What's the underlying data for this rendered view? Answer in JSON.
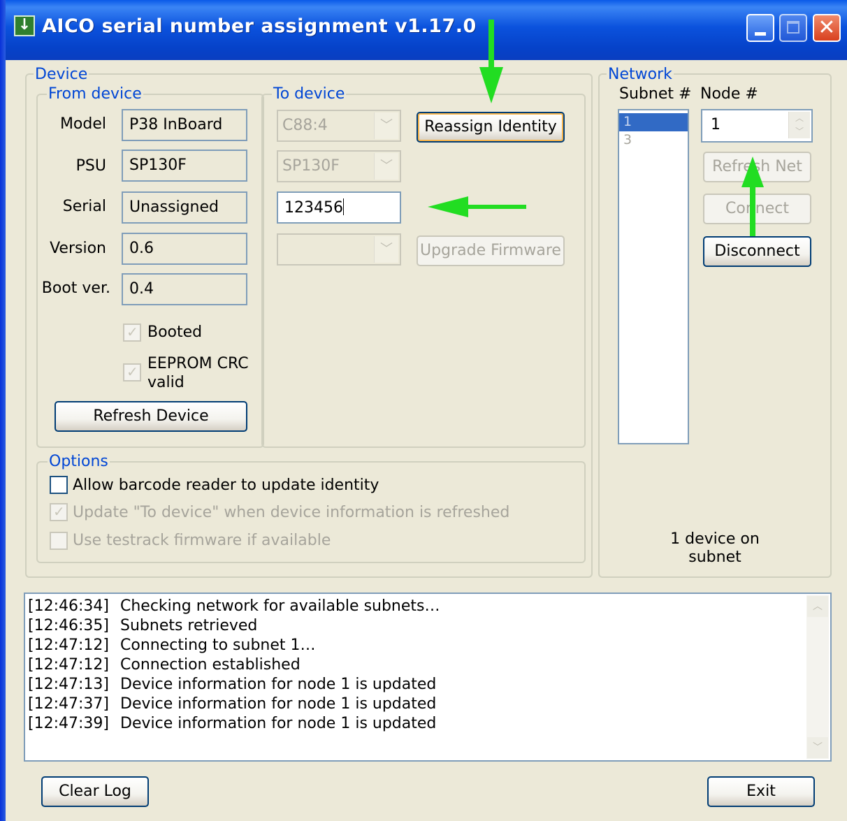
{
  "window": {
    "title": "AICO serial number assignment v1.17.0"
  },
  "device_group": {
    "label": "Device"
  },
  "from_device": {
    "label": "From device",
    "fields": [
      {
        "label": "Model",
        "value": "P38 InBoard"
      },
      {
        "label": "PSU",
        "value": "SP130F"
      },
      {
        "label": "Serial",
        "value": "Unassigned"
      },
      {
        "label": "Version",
        "value": "0.6"
      },
      {
        "label": "Boot ver.",
        "value": "0.4"
      }
    ],
    "booted_label": "Booted",
    "booted": true,
    "eeprom_label_line1": "EEPROM CRC",
    "eeprom_label_line2": "valid",
    "eeprom_valid": true,
    "refresh_button": "Refresh Device"
  },
  "to_device": {
    "label": "To device",
    "model_select": "C88:4",
    "psu_select": "SP130F",
    "serial_input": "123456",
    "firmware_select": "",
    "reassign_button": "Reassign Identity",
    "upgrade_button": "Upgrade Firmware"
  },
  "options": {
    "label": "Options",
    "barcode": {
      "label": "Allow barcode reader to update identity",
      "checked": false
    },
    "update_to_device": {
      "label": "Update \"To device\" when device information is refreshed",
      "checked": true
    },
    "testrack": {
      "label": "Use testrack firmware if available",
      "checked": false
    }
  },
  "network": {
    "label": "Network",
    "subnet_header": "Subnet #",
    "node_header": "Node #",
    "subnets": [
      "1",
      "3"
    ],
    "selected_subnet": "1",
    "node_value": "1",
    "refresh_net_button": "Refresh Net",
    "connect_button": "Connect",
    "disconnect_button": "Disconnect",
    "status": "1 device on subnet"
  },
  "log": [
    {
      "time": "[12:46:34]",
      "message": "Checking network for available subnets…"
    },
    {
      "time": "[12:46:35]",
      "message": "Subnets retrieved"
    },
    {
      "time": "[12:47:12]",
      "message": "Connecting to subnet 1…"
    },
    {
      "time": "[12:47:12]",
      "message": "Connection established"
    },
    {
      "time": "[12:47:13]",
      "message": "Device information for node 1 is updated"
    },
    {
      "time": "[12:47:37]",
      "message": "Device information for node 1 is updated"
    },
    {
      "time": "[12:47:39]",
      "message": "Device information for node 1 is updated"
    }
  ],
  "footer": {
    "clear_log_button": "Clear Log",
    "exit_button": "Exit"
  },
  "colors": {
    "titlebar": "#0a5ae8",
    "group_label": "#0046d5",
    "annotation_arrow": "#22dd22"
  }
}
